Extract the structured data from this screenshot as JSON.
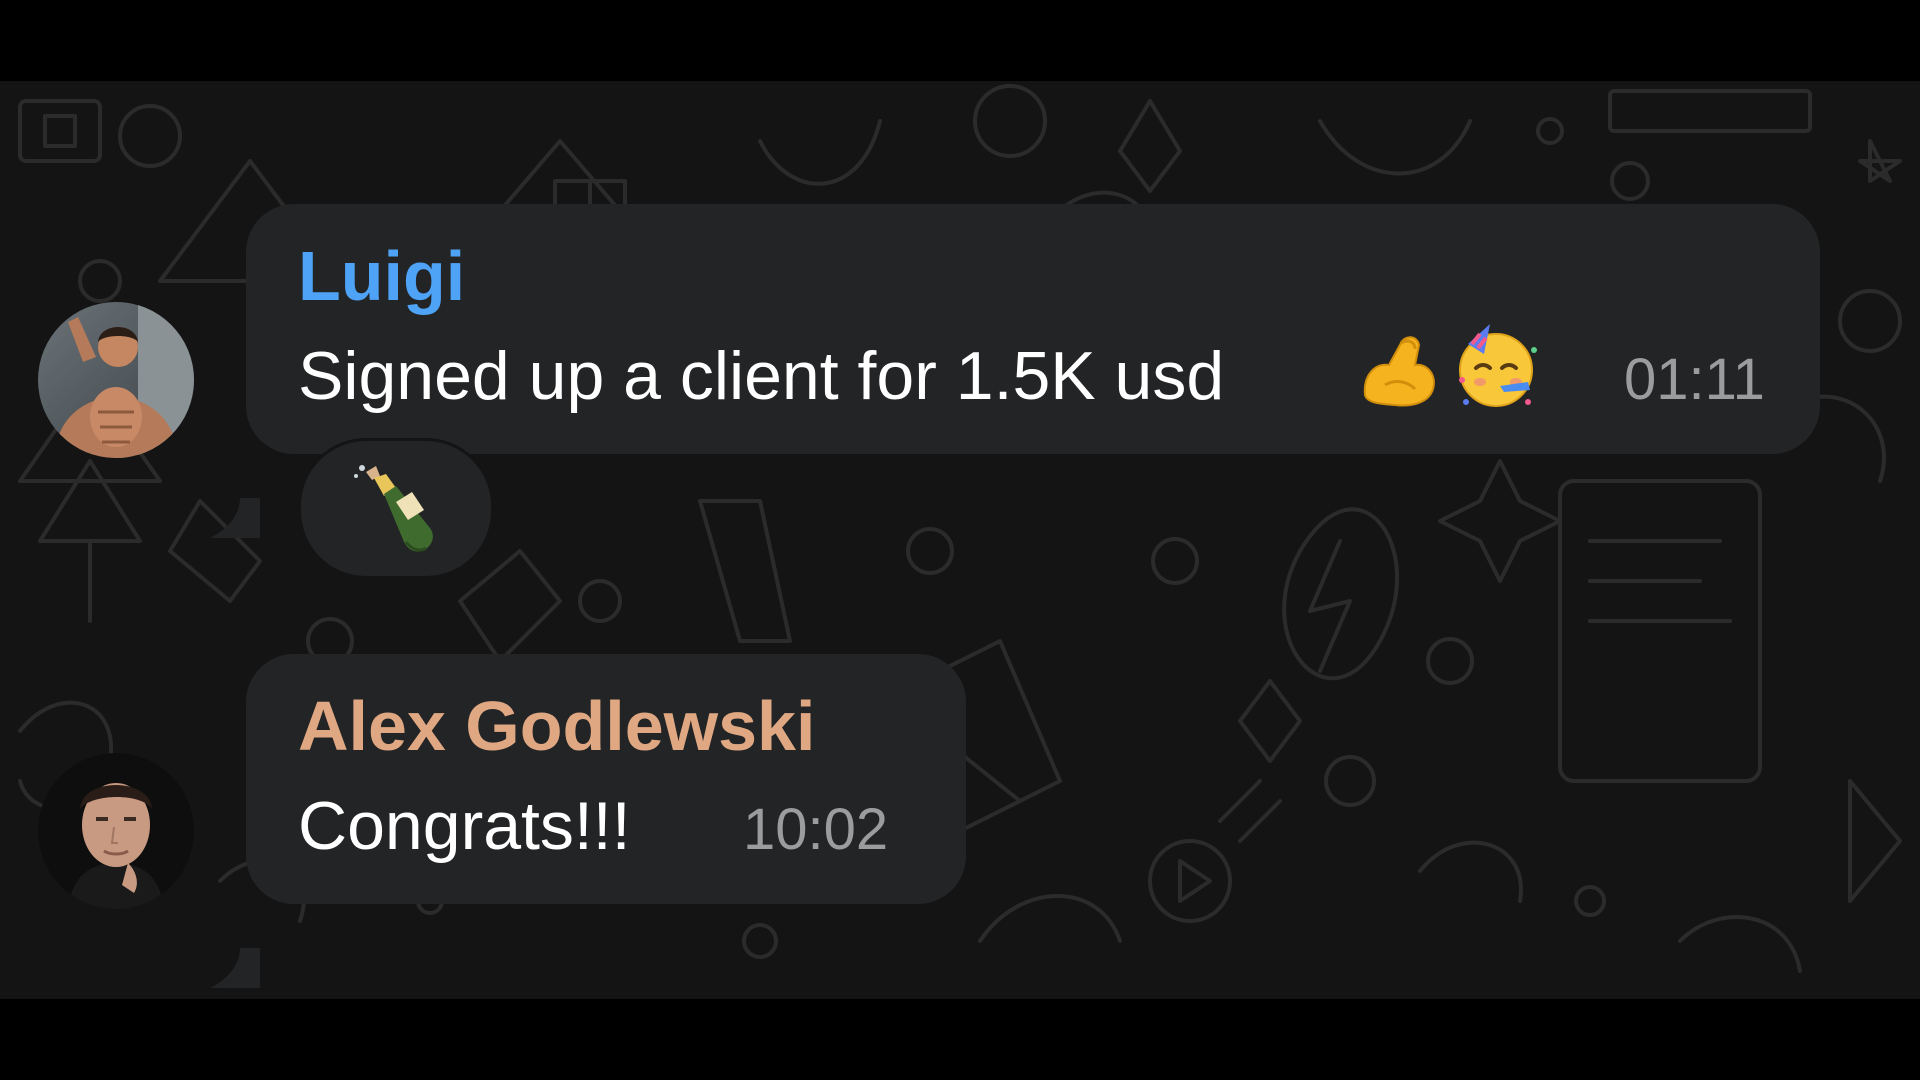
{
  "messages": [
    {
      "sender": "Luigi",
      "sender_color": "#4fa3f7",
      "text": "Signed up a client for 1.5K usd",
      "emojis": [
        "flexed-biceps-icon",
        "partying-face-icon"
      ],
      "time": "01:11",
      "reaction": "champagne-bottle-icon"
    },
    {
      "sender": "Alex Godlewski",
      "sender_color": "#e0a882",
      "text": "Congrats!!!",
      "time": "10:02"
    }
  ],
  "colors": {
    "bubble": "#222426",
    "background": "#141414",
    "time": "#9a9c9e"
  }
}
